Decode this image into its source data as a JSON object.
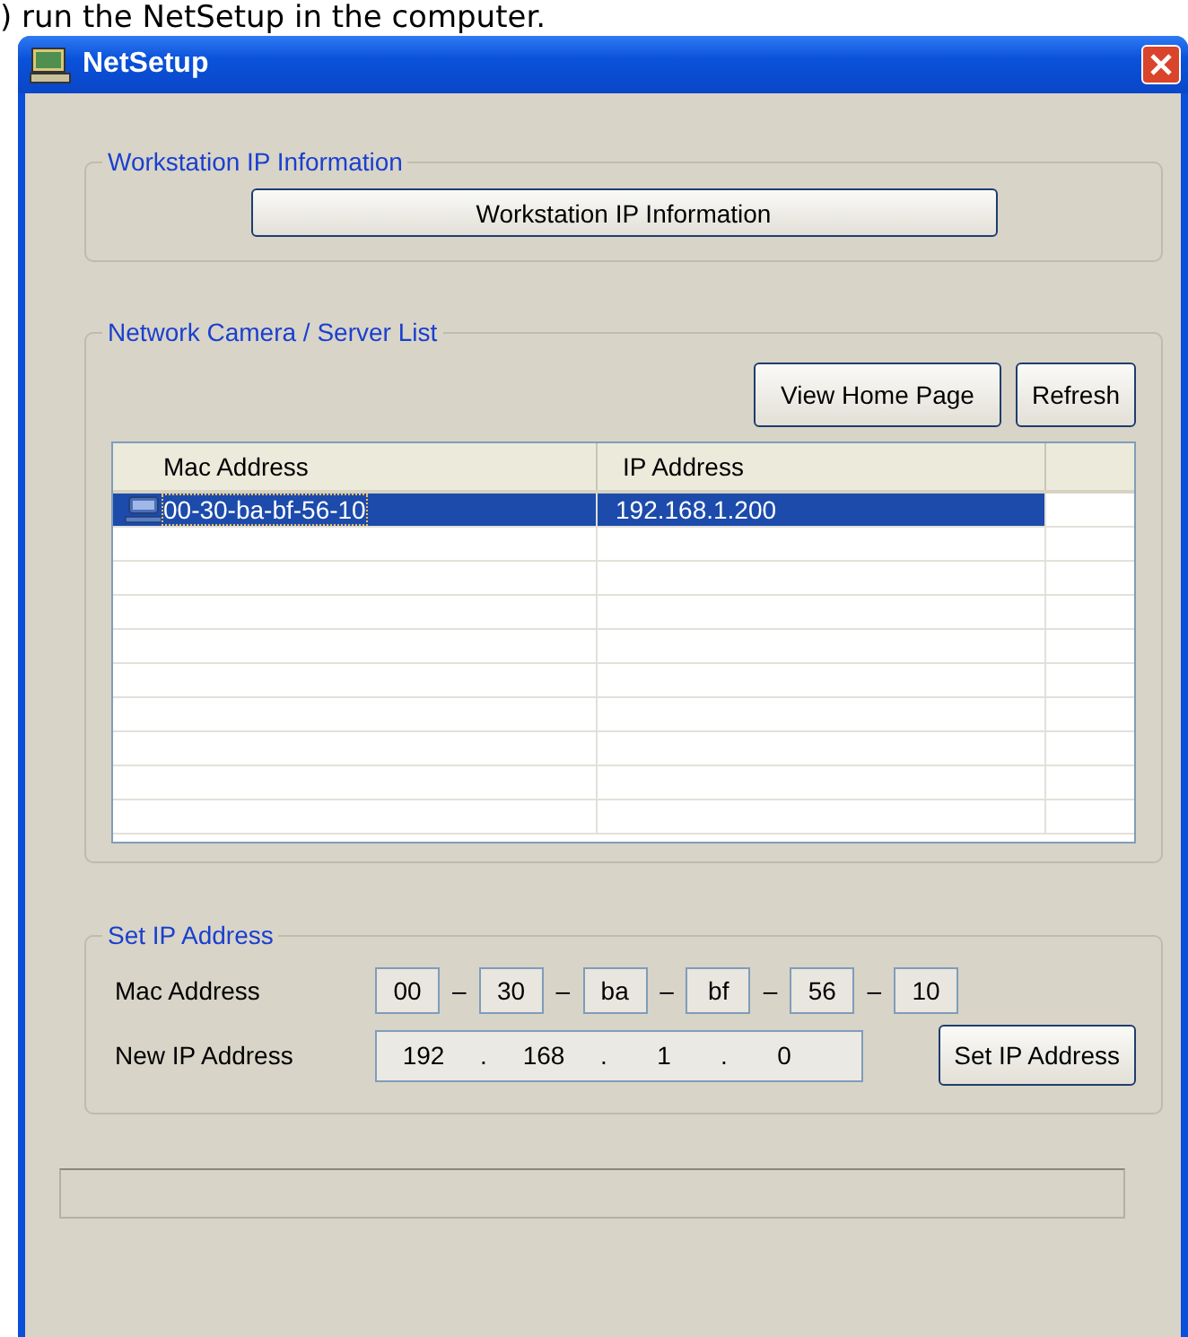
{
  "caption": ") run the NetSetup in the computer.",
  "window": {
    "title": "NetSetup"
  },
  "workstation_group": {
    "title": "Workstation IP Information",
    "button": "Workstation IP Information"
  },
  "server_group": {
    "title": "Network Camera / Server List",
    "buttons": [
      "View Home Page",
      "Refresh"
    ],
    "table": {
      "columns": [
        "Mac Address",
        "IP Address"
      ],
      "rows": [
        {
          "mac": "00-30-ba-bf-56-10",
          "ip": "192.168.1.200",
          "selected": true
        }
      ]
    }
  },
  "set_ip_group": {
    "title": "Set IP Address",
    "mac_label": "Mac Address",
    "mac_octets": [
      "00",
      "30",
      "ba",
      "bf",
      "56",
      "10"
    ],
    "mac_separator": "–",
    "ip_label": "New IP Address",
    "ip_octets": [
      "192",
      "168",
      "1",
      "0"
    ],
    "ip_separator": ".",
    "button": "Set IP Address"
  }
}
